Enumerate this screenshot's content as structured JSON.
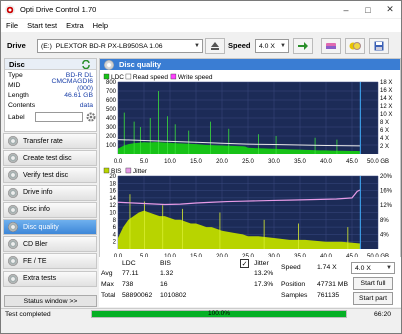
{
  "window": {
    "title": "Opti Drive Control 1.70"
  },
  "menu": [
    "File",
    "Start test",
    "Extra",
    "Help"
  ],
  "drivebar": {
    "drive_label": "Drive",
    "drive_letter": "(E:)",
    "drive_name": "PLEXTOR BD-R  PX-LB950SA 1.06",
    "speed_label": "Speed",
    "speed_value": "4.0 X"
  },
  "disc": {
    "header": "Disc",
    "rows": [
      {
        "key": "Type",
        "value": "BD-R DL"
      },
      {
        "key": "MID",
        "value": "CMCMAGDI6 (000)"
      },
      {
        "key": "Length",
        "value": "46.61 GB"
      },
      {
        "key": "Contents",
        "value": "data"
      },
      {
        "key": "Label",
        "value": ""
      }
    ]
  },
  "nav": [
    {
      "label": "Transfer rate",
      "active": false
    },
    {
      "label": "Create test disc",
      "active": false
    },
    {
      "label": "Verify test disc",
      "active": false
    },
    {
      "label": "Drive info",
      "active": false
    },
    {
      "label": "Disc info",
      "active": false
    },
    {
      "label": "Disc quality",
      "active": true
    },
    {
      "label": "CD Bler",
      "active": false
    },
    {
      "label": "FE / TE",
      "active": false
    },
    {
      "label": "Extra tests",
      "active": false
    }
  ],
  "status_window_btn": "Status window >>",
  "main": {
    "title": "Disc quality"
  },
  "chart_data": [
    {
      "type": "area",
      "legend": [
        "LDC",
        "Read speed",
        "Write speed"
      ],
      "colors": {
        "LDC": "#17c217",
        "Read speed": "#ffffff",
        "Write speed": "#ff40ff"
      },
      "xlim": [
        0,
        50
      ],
      "xunit": "GB",
      "x_ticks": [
        "0.0",
        "5.0",
        "10.0",
        "15.0",
        "20.0",
        "25.0",
        "30.0",
        "35.0",
        "40.0",
        "45.0",
        "50.0 GB"
      ],
      "y_left_ticks": [
        "100",
        "200",
        "300",
        "400",
        "500",
        "600",
        "700",
        "800"
      ],
      "y_right_ticks": [
        "2 X",
        "4 X",
        "6 X",
        "8 X",
        "10 X",
        "12 X",
        "14 X",
        "16 X",
        "18 X"
      ],
      "ylim_left": [
        0,
        800
      ],
      "ldc_profile": [
        [
          0,
          60
        ],
        [
          1,
          90
        ],
        [
          2,
          110
        ],
        [
          3,
          120
        ],
        [
          4,
          125
        ],
        [
          5,
          130
        ],
        [
          6,
          128
        ],
        [
          7,
          132
        ],
        [
          8,
          130
        ],
        [
          9,
          126
        ],
        [
          10,
          124
        ],
        [
          11,
          120
        ],
        [
          12,
          118
        ],
        [
          13,
          115
        ],
        [
          14,
          112
        ],
        [
          15,
          110
        ],
        [
          16,
          105
        ],
        [
          17,
          100
        ],
        [
          18,
          98
        ],
        [
          19,
          96
        ],
        [
          20,
          94
        ],
        [
          21,
          92
        ],
        [
          22,
          90
        ],
        [
          23,
          88
        ],
        [
          24,
          86
        ],
        [
          24.5,
          84
        ],
        [
          25,
          70
        ],
        [
          26,
          66
        ],
        [
          27,
          64
        ],
        [
          28,
          62
        ],
        [
          29,
          60
        ],
        [
          30,
          58
        ],
        [
          31,
          56
        ],
        [
          32,
          54
        ],
        [
          33,
          52
        ],
        [
          34,
          50
        ],
        [
          35,
          48
        ],
        [
          36,
          46
        ],
        [
          37,
          44
        ],
        [
          38,
          42
        ],
        [
          39,
          40
        ],
        [
          40,
          40
        ],
        [
          41,
          38
        ],
        [
          42,
          36
        ],
        [
          43,
          36
        ],
        [
          44,
          35
        ],
        [
          45,
          34
        ],
        [
          46,
          34
        ],
        [
          46.6,
          30
        ]
      ],
      "ldc_spikes": [
        [
          1.2,
          460
        ],
        [
          3.1,
          360
        ],
        [
          4.3,
          300
        ],
        [
          6.2,
          400
        ],
        [
          7.8,
          700
        ],
        [
          9.5,
          420
        ],
        [
          11.0,
          330
        ],
        [
          13.6,
          260
        ],
        [
          17.8,
          360
        ],
        [
          21.3,
          280
        ],
        [
          27.0,
          220
        ],
        [
          30.4,
          200
        ],
        [
          37.9,
          180
        ],
        [
          42.1,
          160
        ]
      ],
      "read_speed": [
        [
          0,
          160
        ],
        [
          5,
          150
        ],
        [
          10,
          140
        ],
        [
          15,
          130
        ],
        [
          20,
          120
        ],
        [
          25,
          110
        ],
        [
          30,
          105
        ],
        [
          35,
          100
        ],
        [
          40,
          95
        ],
        [
          46.6,
          90
        ]
      ]
    },
    {
      "type": "area",
      "legend": [
        "BIS",
        "Jitter"
      ],
      "colors": {
        "BIS": "#b8d400",
        "Jitter": "#e79be7"
      },
      "xlim": [
        0,
        50
      ],
      "xunit": "GB",
      "x_ticks": [
        "0.0",
        "5.0",
        "10.0",
        "15.0",
        "20.0",
        "25.0",
        "30.0",
        "35.0",
        "40.0",
        "45.0",
        "50.0 GB"
      ],
      "y_left_ticks": [
        "2",
        "4",
        "6",
        "8",
        "10",
        "12",
        "14",
        "16",
        "18",
        "20"
      ],
      "y_right_ticks": [
        "4%",
        "8%",
        "12%",
        "16%",
        "20%"
      ],
      "ylim_left": [
        0,
        20
      ],
      "ylim_right": [
        0,
        20
      ],
      "bis_profile": [
        [
          0,
          3
        ],
        [
          1,
          6
        ],
        [
          2,
          8
        ],
        [
          3,
          9
        ],
        [
          4,
          10
        ],
        [
          5,
          10.5
        ],
        [
          6,
          10
        ],
        [
          7,
          9.5
        ],
        [
          8,
          9
        ],
        [
          9,
          9
        ],
        [
          10,
          8.5
        ],
        [
          11,
          8
        ],
        [
          12,
          8
        ],
        [
          13,
          7.5
        ],
        [
          14,
          7
        ],
        [
          15,
          7
        ],
        [
          16,
          6.5
        ],
        [
          17,
          6
        ],
        [
          18,
          6
        ],
        [
          19,
          5.5
        ],
        [
          20,
          5
        ],
        [
          22,
          4.5
        ],
        [
          24,
          4
        ],
        [
          25,
          3.5
        ],
        [
          27,
          3.5
        ],
        [
          30,
          3
        ],
        [
          33,
          2.5
        ],
        [
          36,
          2.5
        ],
        [
          40,
          2
        ],
        [
          43,
          2
        ],
        [
          46.6,
          1.5
        ]
      ],
      "bis_spikes": [
        [
          2.3,
          15
        ],
        [
          5.1,
          13
        ],
        [
          8.6,
          12
        ],
        [
          12.4,
          11
        ],
        [
          19.6,
          10
        ],
        [
          28.1,
          8
        ],
        [
          34.7,
          7
        ],
        [
          44.2,
          6
        ]
      ],
      "jitter": [
        [
          0,
          12.8
        ],
        [
          3,
          12.6
        ],
        [
          6,
          12.4
        ],
        [
          9,
          12.2
        ],
        [
          12,
          12.3
        ],
        [
          15,
          12.6
        ],
        [
          18,
          12.8
        ],
        [
          21,
          13.0
        ],
        [
          24,
          13.1
        ],
        [
          27,
          13.2
        ],
        [
          30,
          13.3
        ],
        [
          33,
          13.4
        ],
        [
          36,
          13.5
        ],
        [
          39,
          13.6
        ],
        [
          42,
          13.7
        ],
        [
          45,
          14.0
        ],
        [
          46,
          15.8
        ],
        [
          46.6,
          16.2
        ]
      ]
    }
  ],
  "stats": {
    "col_ldc": "LDC",
    "col_bis": "BIS",
    "rows": [
      {
        "label": "Avg",
        "ldc": "77.11",
        "bis": "1.32"
      },
      {
        "label": "Max",
        "ldc": "738",
        "bis": "16"
      },
      {
        "label": "Total",
        "ldc": "58890062",
        "bis": "1010802"
      }
    ],
    "jitter_label": "Jitter",
    "jitter_checked": true,
    "jitter_avg": "13.2%",
    "jitter_max": "17.3%",
    "speed_label": "Speed",
    "speed_value": "1.74 X",
    "position_label": "Position",
    "position_value": "47731 MB",
    "samples_label": "Samples",
    "samples_value": "761135",
    "speed_select": "4.0 X",
    "btn_start_full": "Start full",
    "btn_start_part": "Start part"
  },
  "statusbar": {
    "text": "Test completed",
    "progress": 1.0,
    "progress_text": "100.0%",
    "time": "66:20"
  }
}
